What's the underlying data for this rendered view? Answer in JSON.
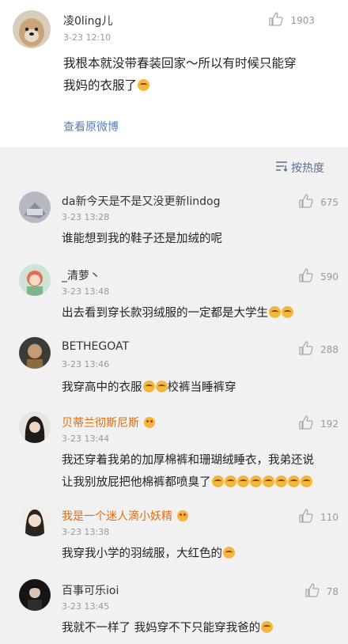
{
  "post": {
    "author": "凌0ling儿",
    "time": "3-23 12:10",
    "likes": "1903",
    "text_line1": "我根本就没带春装回家～所以有时候只能穿",
    "text_line2": "我妈的衣服了",
    "view_original": "查看原微博"
  },
  "sort": {
    "label": "按热度"
  },
  "comments": [
    {
      "author": "da新今天是不是又没更新lindog",
      "time": "3-23 13:28",
      "likes": "675",
      "text": "谁能想到我的鞋子还是加绒的呢"
    },
    {
      "author": "_清萝丶",
      "time": "3-23 13:48",
      "likes": "590",
      "text": "出去看到穿长款羽绒服的一定都是大学生"
    },
    {
      "author": "BETHEGOAT",
      "time": "3-23 13:46",
      "likes": "288",
      "text_a": "我穿高中的衣服",
      "text_b": "校裤当睡裤穿"
    },
    {
      "author": "贝蒂兰彻斯尼斯",
      "time": "3-23 13:44",
      "likes": "192",
      "text_line1": "我还穿着我弟的加厚棉裤和珊瑚绒睡衣，我弟还说",
      "text_line2": "让我别放屁把他棉裤都喷臭了"
    },
    {
      "author": "我是一个迷人滴小妖精",
      "time": "3-23 13:38",
      "likes": "110",
      "text": "我穿我小学的羽绒服，大红色的"
    },
    {
      "author": "百事可乐ioi",
      "time": "3-23 13:45",
      "likes": "78",
      "text": "我就不一样了 我妈穿不下只能穿我爸的"
    }
  ],
  "colors": {
    "vip_name": "#e86b0e",
    "link": "#5a7eb5",
    "background": "#f1f1f1"
  }
}
